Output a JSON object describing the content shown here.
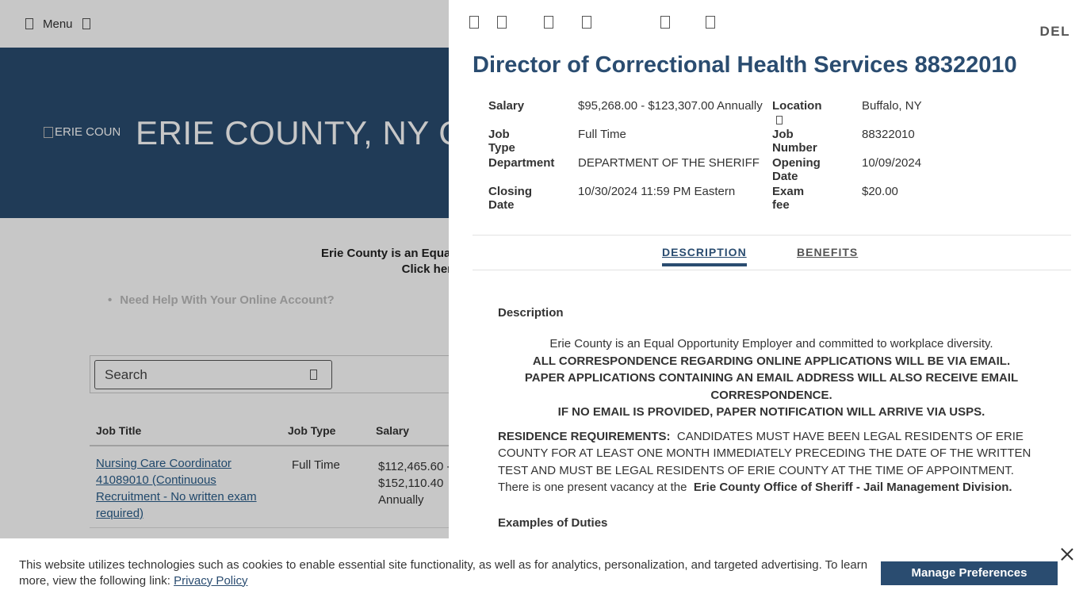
{
  "background": {
    "menu_label": "Menu",
    "logo_alt": "ERIE COUNTY",
    "site_title": "ERIE COUNTY, NY CIVIL SERVICE",
    "notice_line1": "Erie County is an Equal Opportunity Employer",
    "notice_line2": "Click here to view",
    "help_item": "Need Help With Your Online Account?",
    "search_placeholder": "Search",
    "table": {
      "headers": {
        "title": "Job Title",
        "type": "Job Type",
        "salary": "Salary"
      },
      "rows": [
        {
          "title": "Nursing Care Coordinator 41089010 (Continuous Recruitment - No written exam required)",
          "type": "Full Time",
          "salary": "$112,465.60 - $152,110.40 Annually"
        }
      ]
    }
  },
  "panel": {
    "delete_label": "DEL",
    "job_title": "Director of Correctional Health Services 88322010",
    "details": {
      "salary_label": "Salary",
      "salary": "$95,268.00 - $123,307.00 Annually",
      "location_label": "Location",
      "location": "Buffalo, NY",
      "job_type_label": "Job Type",
      "job_type": "Full Time",
      "job_number_label": "Job Number",
      "job_number": "88322010",
      "department_label": "Department",
      "department": "DEPARTMENT OF THE SHERIFF",
      "opening_date_label": "Opening Date",
      "opening_date": "10/09/2024",
      "closing_date_label": "Closing Date",
      "closing_date": "10/30/2024 11:59 PM Eastern",
      "exam_fee_label": "Exam fee",
      "exam_fee": "$20.00"
    },
    "tabs": [
      {
        "label": "DESCRIPTION",
        "active": true
      },
      {
        "label": "BENEFITS",
        "active": false
      }
    ],
    "description": {
      "heading": "Description",
      "eeo": "Erie County is an Equal Opportunity Employer and committed to workplace diversity.",
      "line_email": "ALL CORRESPONDENCE REGARDING ONLINE APPLICATIONS WILL BE VIA EMAIL.",
      "line_paper": "PAPER APPLICATIONS CONTAINING AN EMAIL ADDRESS WILL ALSO RECEIVE EMAIL CORRESPONDENCE.",
      "line_usps": "IF NO EMAIL IS PROVIDED, PAPER NOTIFICATION WILL ARRIVE VIA USPS.",
      "residence_label": "RESIDENCE REQUIREMENTS:",
      "residence_text": "CANDIDATES MUST HAVE BEEN LEGAL RESIDENTS OF ERIE COUNTY FOR AT LEAST ONE MONTH IMMEDIATELY PRECEDING THE DATE OF THE WRITTEN TEST AND MUST BE LEGAL RESIDENTS OF ERIE COUNTY AT THE TIME OF APPOINTMENT.",
      "vacancy_text": "There is one present vacancy at the",
      "vacancy_bold": "Erie County Office of Sheriff - Jail Management Division.",
      "duties_heading": "Examples of Duties"
    }
  },
  "cookie": {
    "text": "This website utilizes technologies such as cookies to enable essential site functionality, as well as for analytics, personalization, and targeted advertising. To learn more, view the following link:",
    "link": "Privacy Policy",
    "button": "Manage Preferences"
  },
  "colors": {
    "brand": "#2a4c70",
    "link": "#2a5d8a"
  },
  "icons": [
    "hamburger-icon",
    "chevron-icon",
    "search-icon",
    "sort-icon",
    "map-marker-icon",
    "print-icon",
    "share-icon",
    "email-icon",
    "bookmark-icon",
    "close-icon"
  ]
}
